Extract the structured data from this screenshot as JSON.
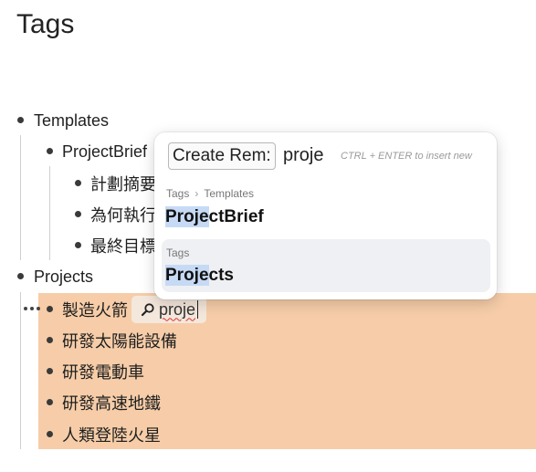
{
  "page": {
    "title": "Tags"
  },
  "tree": {
    "templates": {
      "label": "Templates"
    },
    "project_brief": {
      "label": "ProjectBrief"
    },
    "brief_children": [
      "計劃摘要",
      "為何執行",
      "最終目標"
    ],
    "projects": {
      "label": "Projects"
    },
    "project_items": [
      "製造火箭",
      "研發太陽能設備",
      "研發電動車",
      "研發高速地鐵",
      "人類登陸火星"
    ],
    "highlight_color": "#f6cda8"
  },
  "search": {
    "value": "proje",
    "icon": "search-icon"
  },
  "popup": {
    "create_label": "Create Rem:",
    "query": "proje",
    "hint": "CTRL + ENTER to insert new",
    "results": [
      {
        "path": [
          "Tags",
          "Templates"
        ],
        "match": "Proje",
        "rest": "ctBrief"
      },
      {
        "path": [
          "Tags"
        ],
        "match": "Proje",
        "rest": "cts"
      }
    ]
  }
}
